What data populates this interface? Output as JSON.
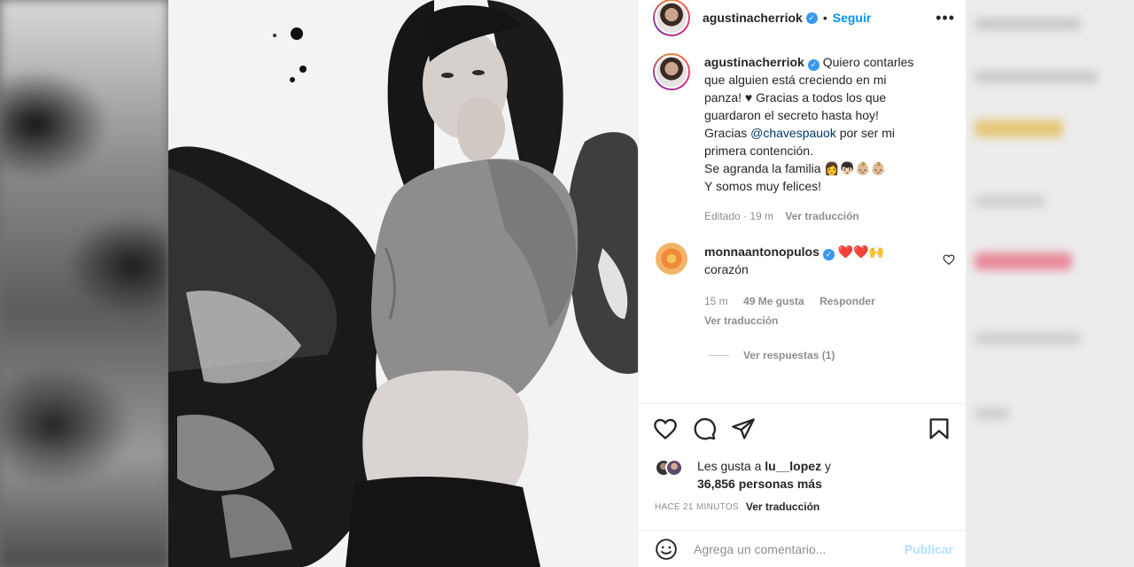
{
  "post": {
    "author": "agustinacherriok",
    "follow_label": "Seguir",
    "dot": "•",
    "more_label": "•••",
    "caption_lines": [
      "Quiero contarles",
      "que alguien está creciendo en mi",
      "panza! ♥ Gracias a todos los que",
      "guardaron el secreto hasta hoy!"
    ],
    "caption_gracias": "Gracias",
    "caption_mention": "@chavespauok",
    "caption_after_mention": "por ser mi",
    "caption_line6": "primera contención.",
    "caption_line7": "Se agranda la familia 👩👦🏻👶🏼👶🏼",
    "caption_line8": "Y somos muy felices!",
    "edited_label": "Editado · 19 m",
    "translate_label": "Ver traducción"
  },
  "comment": {
    "author": "monnaantonopulos",
    "text_inline": "❤️❤️🙌",
    "text_line2": "corazón",
    "time": "15 m",
    "likes": "49 Me gusta",
    "reply_label": "Responder",
    "translate_label": "Ver traducción",
    "view_replies": "Ver respuestas (1)"
  },
  "likes": {
    "prefix": "Les gusta a",
    "user": "lu__lopez",
    "joiner": "y",
    "count": "36,856 personas más"
  },
  "timestamp": {
    "label": "HACE 21 MINUTOS",
    "translate_label": "Ver traducción"
  },
  "add_comment": {
    "placeholder": "Agrega un comentario...",
    "publish_label": "Publicar"
  },
  "colors": {
    "accent": "#0095f6",
    "verified": "#3897f0",
    "text": "#262626",
    "muted": "#8e8e8e",
    "publish_disabled": "#b2dffc"
  }
}
